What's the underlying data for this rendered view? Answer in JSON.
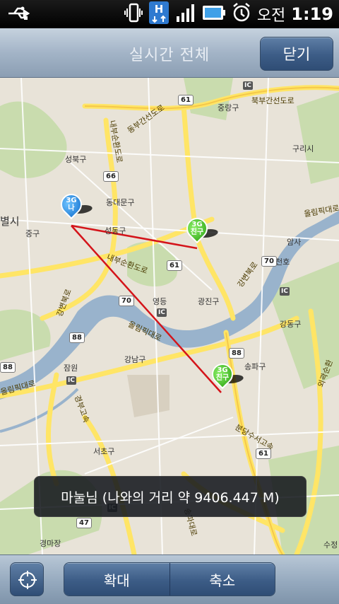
{
  "status_bar": {
    "ampm": "오전",
    "time": "1:19"
  },
  "header": {
    "title": "실시간 전체",
    "close_label": "닫기"
  },
  "map": {
    "districts": [
      "성북구",
      "중랑구",
      "동대문구",
      "성동구",
      "광진구",
      "구리시",
      "중구",
      "영등",
      "강동구",
      "송파구",
      "강남구",
      "서초구",
      "잠원",
      "천호",
      "암사",
      "경마장",
      "수정",
      "별시"
    ],
    "roads": [
      "북부간선도로",
      "동부간선도로",
      "내부순환도로",
      "강변북로",
      "올림픽대로",
      "올림픽대로",
      "경부고속",
      "분당수서고속",
      "송파대로",
      "올림픽대로",
      "강변북로",
      "외곽순환"
    ],
    "shields": [
      "61",
      "66",
      "61",
      "70",
      "70",
      "88",
      "88",
      "47",
      "61",
      "88"
    ],
    "ic_badge": "IC",
    "markers": [
      {
        "label_top": "3G",
        "label_bottom": "나",
        "color": "blue"
      },
      {
        "label_top": "3G",
        "label_bottom": "친구",
        "color": "green"
      },
      {
        "label_top": "3G",
        "label_bottom": "친구",
        "color": "green"
      }
    ],
    "info_toast": "마눌님 (나와의 거리 약 9406.447 M)"
  },
  "toolbar": {
    "zoom_in_label": "확대",
    "zoom_out_label": "축소"
  },
  "colors": {
    "route_line": "#d4141a",
    "river": "#99b3cc",
    "highway": "#ffe566"
  }
}
